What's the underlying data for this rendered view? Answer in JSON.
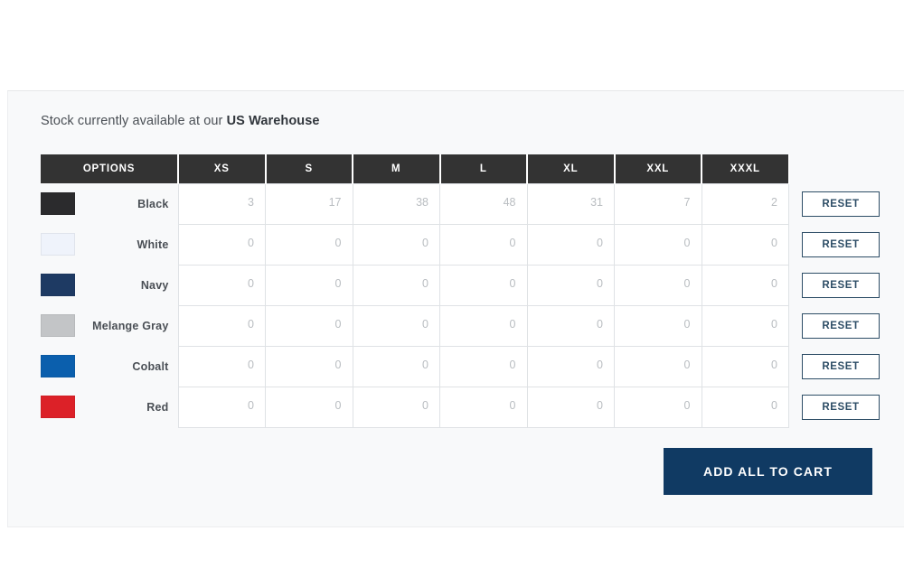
{
  "panel": {
    "heading_prefix": "Stock currently available at our ",
    "heading_location": "US Warehouse"
  },
  "table": {
    "columns": [
      "OPTIONS",
      "XS",
      "S",
      "M",
      "L",
      "XL",
      "XXL",
      "XXXL"
    ],
    "rows": [
      {
        "color_name": "Black",
        "swatch_hex": "#2b2b2d",
        "stock": [
          "3",
          "17",
          "38",
          "48",
          "31",
          "7",
          "2"
        ],
        "values": [
          "",
          "",
          "",
          "",
          "",
          "",
          ""
        ],
        "reset_label": "RESET"
      },
      {
        "color_name": "White",
        "swatch_hex": "#eff3fb",
        "stock": [
          "0",
          "0",
          "0",
          "0",
          "0",
          "0",
          "0"
        ],
        "values": [
          "",
          "",
          "",
          "",
          "",
          "",
          ""
        ],
        "reset_label": "RESET"
      },
      {
        "color_name": "Navy",
        "swatch_hex": "#1e3a63",
        "stock": [
          "0",
          "0",
          "0",
          "0",
          "0",
          "0",
          "0"
        ],
        "values": [
          "",
          "",
          "",
          "",
          "",
          "",
          ""
        ],
        "reset_label": "RESET"
      },
      {
        "color_name": "Melange Gray",
        "swatch_hex": "#c3c5c7",
        "stock": [
          "0",
          "0",
          "0",
          "0",
          "0",
          "0",
          "0"
        ],
        "values": [
          "",
          "",
          "",
          "",
          "",
          "",
          ""
        ],
        "reset_label": "RESET"
      },
      {
        "color_name": "Cobalt",
        "swatch_hex": "#0b5fad",
        "stock": [
          "0",
          "0",
          "0",
          "0",
          "0",
          "0",
          "0"
        ],
        "values": [
          "",
          "",
          "",
          "",
          "",
          "",
          ""
        ],
        "reset_label": "RESET"
      },
      {
        "color_name": "Red",
        "swatch_hex": "#dc2128",
        "stock": [
          "0",
          "0",
          "0",
          "0",
          "0",
          "0",
          "0"
        ],
        "values": [
          "",
          "",
          "",
          "",
          "",
          "",
          ""
        ],
        "reset_label": "RESET"
      }
    ]
  },
  "actions": {
    "add_all_to_cart_label": "ADD ALL TO CART"
  },
  "colors": {
    "header_bg": "#333333",
    "panel_bg": "#f8f9fa",
    "accent_navy": "#103a63",
    "reset_border": "#2d4d66"
  }
}
